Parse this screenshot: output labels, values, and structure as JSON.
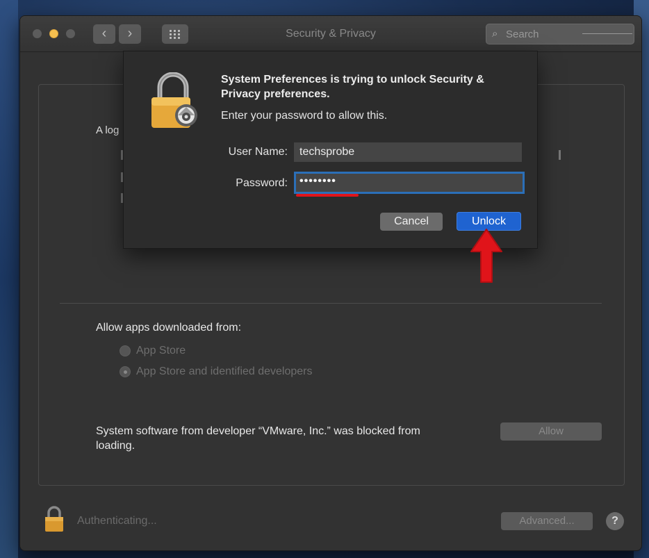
{
  "window": {
    "title": "Security & Privacy",
    "search_placeholder": "Search",
    "back_glyph": "‹",
    "forward_glyph": "›"
  },
  "panel": {
    "partial_text": "A log",
    "allow_apps_label": "Allow apps downloaded from:",
    "radio_options": [
      {
        "label": "App Store",
        "selected": false
      },
      {
        "label": "App Store and identified developers",
        "selected": true
      }
    ],
    "blocked_message": "System software from developer “VMware, Inc.” was blocked from loading.",
    "allow_button": "Allow"
  },
  "footer": {
    "status_text": "Authenticating...",
    "advanced_button": "Advanced...",
    "help_button": "?"
  },
  "dialog": {
    "title": "System Preferences is trying to unlock Security & Privacy preferences.",
    "subtitle": "Enter your password to allow this.",
    "username_label": "User Name:",
    "username_value": "techsprobe",
    "password_label": "Password:",
    "password_masked": "••••••••",
    "cancel_button": "Cancel",
    "unlock_button": "Unlock"
  },
  "colors": {
    "accent_blue": "#1f63d0",
    "annotation_red": "#e0141a",
    "lock_gold": "#e6a83a"
  },
  "icons": [
    "lock-icon",
    "gear-icon",
    "search-icon",
    "help-icon",
    "arrow-up-icon"
  ]
}
